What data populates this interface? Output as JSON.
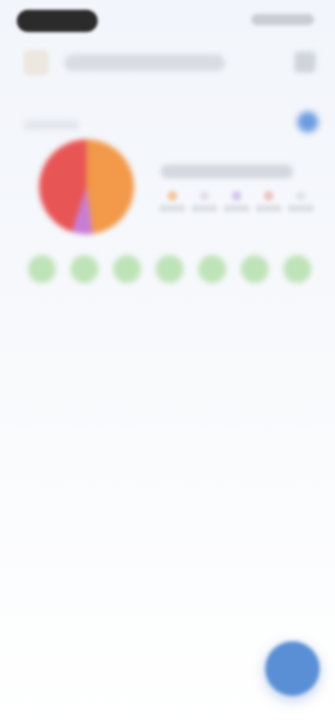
{
  "status_bar": {
    "time": ""
  },
  "header": {
    "title": "",
    "menu_icon": "menu-icon"
  },
  "summary": {
    "label": "",
    "info_icon": "info-icon",
    "legend_title": "",
    "pie": {
      "colors": [
        "#e85555",
        "#f2994a",
        "#c77dd6"
      ],
      "shares": [
        0.45,
        0.48,
        0.07
      ]
    },
    "legend_items": [
      {
        "label": "",
        "color": "#f3c79c"
      },
      {
        "label": "",
        "color": "#e6e0ec"
      },
      {
        "label": "",
        "color": "#d9c6ef"
      },
      {
        "label": "",
        "color": "#f0c4c4"
      },
      {
        "label": "",
        "color": "#e2e6ea"
      }
    ]
  },
  "days": [
    {
      "label": ""
    },
    {
      "label": ""
    },
    {
      "label": ""
    },
    {
      "label": ""
    },
    {
      "label": ""
    },
    {
      "label": ""
    },
    {
      "label": ""
    }
  ],
  "fab": {
    "icon": "plus-icon"
  }
}
